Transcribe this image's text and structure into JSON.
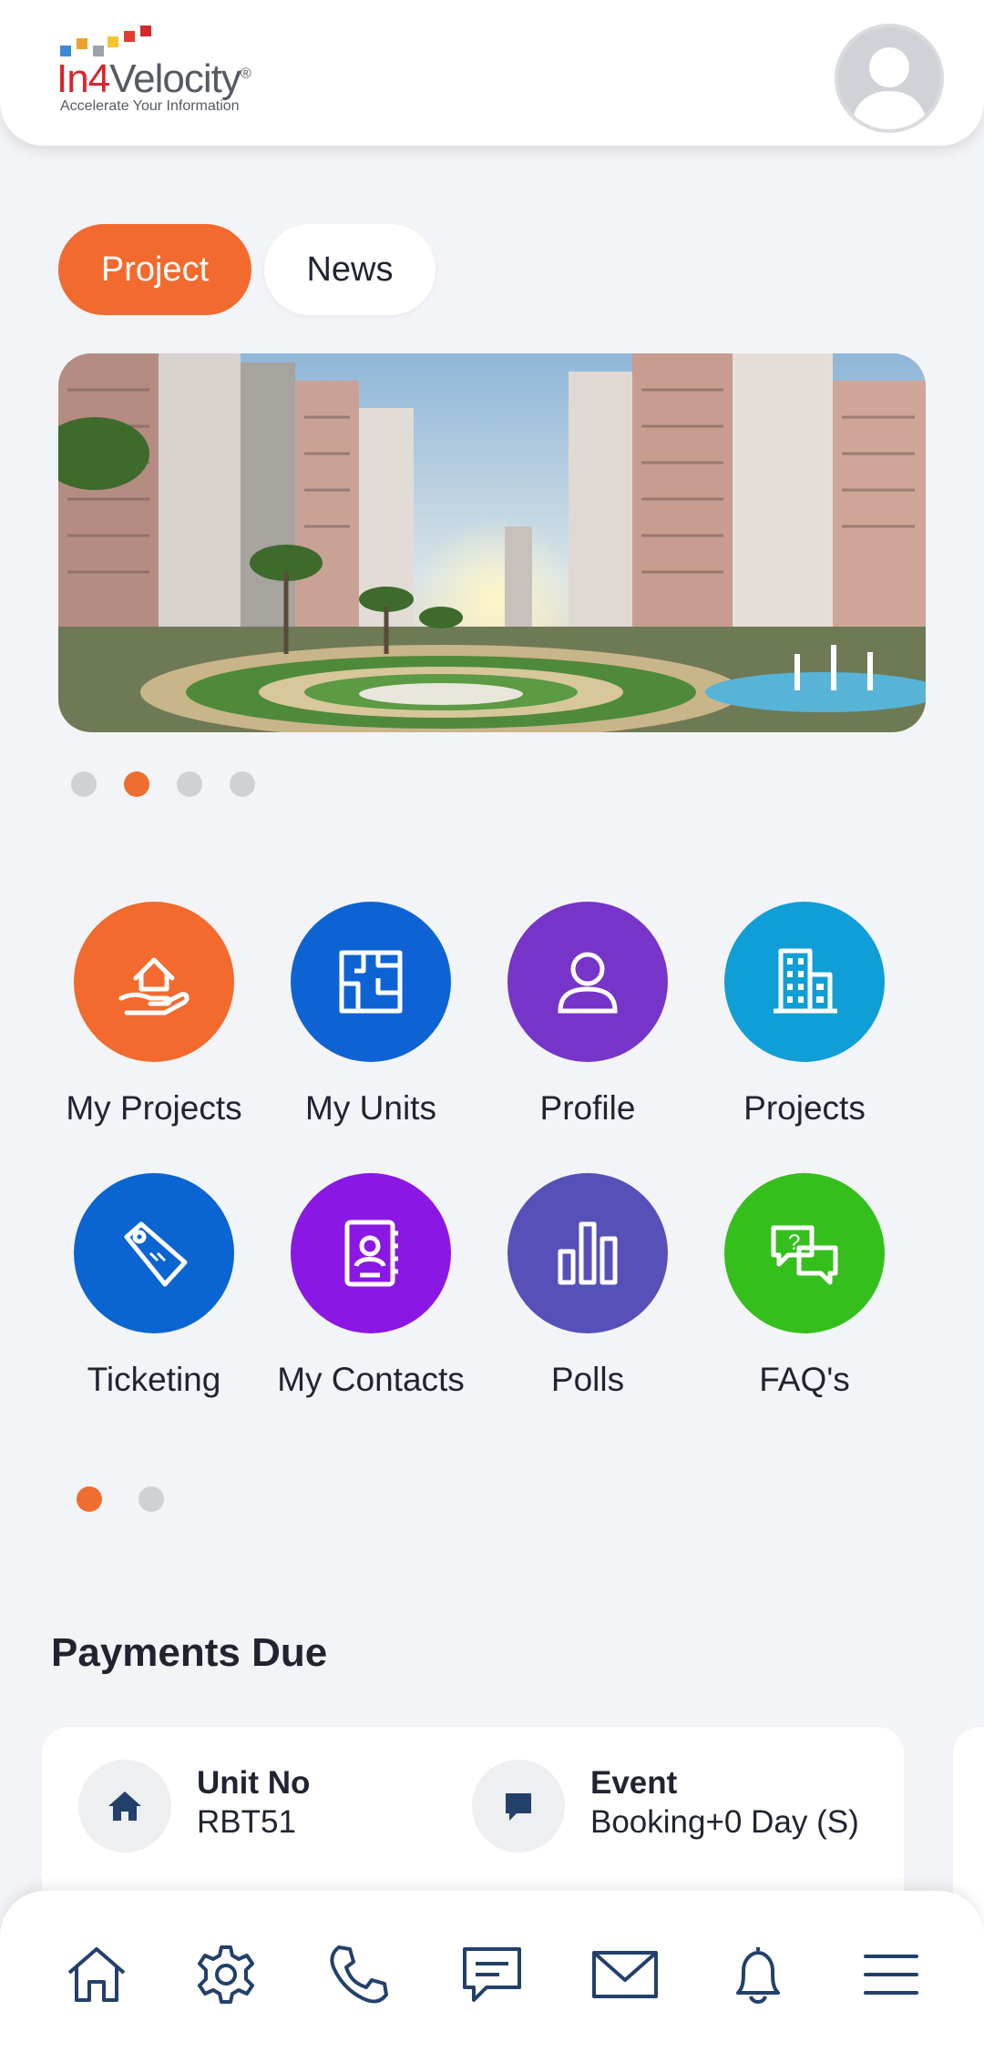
{
  "header": {
    "logo_prefix": "In",
    "logo_four": "4",
    "logo_suffix": "Velocity",
    "logo_registered": "®",
    "logo_tagline": "Accelerate Your Information",
    "avatar_icon": "user-avatar-icon"
  },
  "tabs": [
    {
      "label": "Project",
      "active": true
    },
    {
      "label": "News",
      "active": false
    }
  ],
  "banner": {
    "slide_count": 4,
    "active_slide": 2
  },
  "menu": [
    {
      "label": "My Projects",
      "icon": "home-hand-icon",
      "color": "#f26a2e"
    },
    {
      "label": "My Units",
      "icon": "floor-plan-icon",
      "color": "#0e63d4"
    },
    {
      "label": "Profile",
      "icon": "person-icon",
      "color": "#7634c9"
    },
    {
      "label": "Projects",
      "icon": "building-icon",
      "color": "#0f9fd6"
    },
    {
      "label": "Ticketing",
      "icon": "tag-icon",
      "color": "#0a64d2"
    },
    {
      "label": "My Contacts",
      "icon": "contact-book-icon",
      "color": "#8a17e3"
    },
    {
      "label": "Polls",
      "icon": "bar-chart-icon",
      "color": "#5650b8"
    },
    {
      "label": "FAQ's",
      "icon": "chat-question-icon",
      "color": "#34bf1c"
    }
  ],
  "menu_pages": {
    "count": 2,
    "active": 1
  },
  "payments": {
    "title": "Payments Due",
    "unit_label": "Unit No",
    "unit_value": "RBT51",
    "event_label": "Event",
    "event_value": "Booking+0 Day (S)"
  },
  "bottom_nav": [
    "home-icon",
    "settings-gear-icon",
    "phone-icon",
    "chat-icon",
    "mail-icon",
    "bell-icon",
    "menu-icon"
  ],
  "colors": {
    "accent": "#f26a2e",
    "nav_icon": "#22406a",
    "background": "#f3f4f7"
  }
}
